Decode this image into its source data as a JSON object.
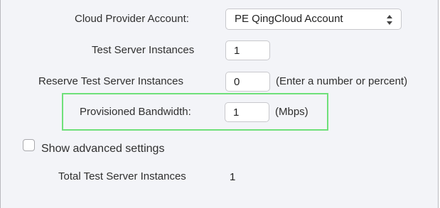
{
  "form": {
    "cloud_provider_label": "Cloud Provider Account:",
    "cloud_provider_value": "PE QingCloud Account",
    "test_server_label": "Test Server Instances",
    "test_server_value": "1",
    "reserve_label": "Reserve Test Server Instances",
    "reserve_value": "0",
    "reserve_hint": "(Enter a number or percent)",
    "bandwidth_label": "Provisioned Bandwidth:",
    "bandwidth_value": "1",
    "bandwidth_unit": "(Mbps)",
    "advanced_label": "Show advanced settings",
    "advanced_checked": false,
    "total_label": "Total Test Server Instances",
    "total_value": "1"
  },
  "colors": {
    "highlight_border": "#6fe07a",
    "panel_background": "#f3f4f8"
  },
  "icons": {
    "select_arrows": "up-down-arrows-icon",
    "checkbox": "checkbox-icon"
  }
}
